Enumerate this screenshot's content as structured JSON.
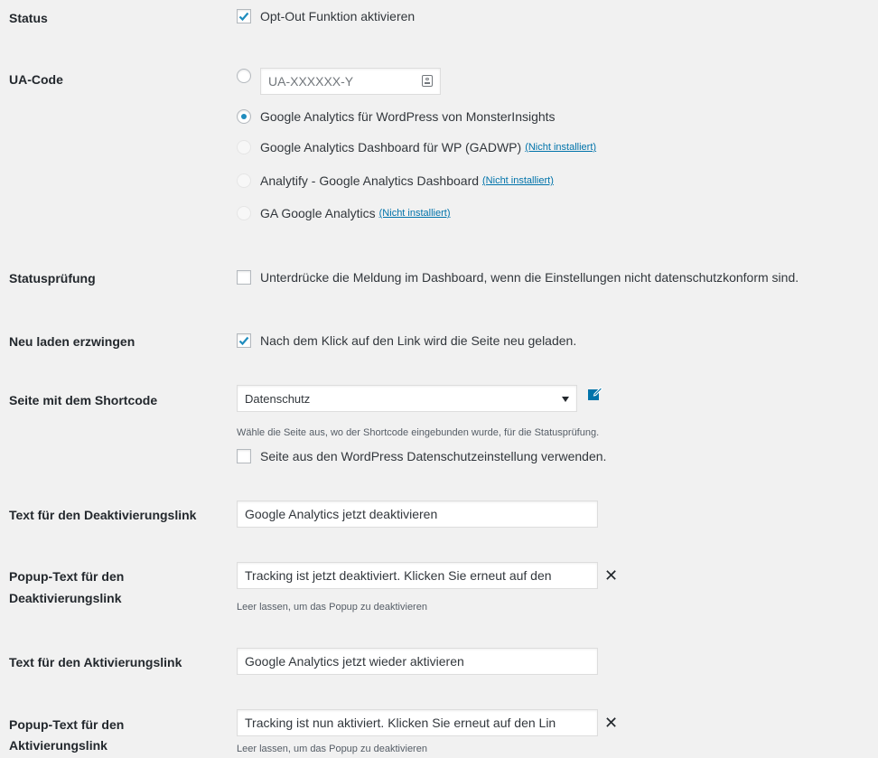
{
  "status": {
    "label": "Status",
    "checkbox_label": "Opt-Out Funktion aktivieren",
    "checked": true
  },
  "ua_code": {
    "label": "UA-Code",
    "input_placeholder": "UA-XXXXXX-Y",
    "options": [
      {
        "label": "Google Analytics für WordPress von MonsterInsights",
        "selected": true,
        "disabled": false,
        "note": ""
      },
      {
        "label": "Google Analytics Dashboard für WP (GADWP)",
        "selected": false,
        "disabled": true,
        "note": "(Nicht installiert)"
      },
      {
        "label": "Analytify - Google Analytics Dashboard",
        "selected": false,
        "disabled": true,
        "note": "(Nicht installiert)"
      },
      {
        "label": "GA Google Analytics",
        "selected": false,
        "disabled": true,
        "note": "(Nicht installiert)"
      }
    ]
  },
  "status_check": {
    "label": "Statusprüfung",
    "checkbox_label": "Unterdrücke die Meldung im Dashboard, wenn die Einstellungen nicht datenschutzkonform sind.",
    "checked": false
  },
  "force_reload": {
    "label": "Neu laden erzwingen",
    "checkbox_label": "Nach dem Klick auf den Link wird die Seite neu geladen.",
    "checked": true
  },
  "shortcode_page": {
    "label": "Seite mit dem Shortcode",
    "selected": "Datenschutz",
    "help": "Wähle die Seite aus, wo der Shortcode eingebunden wurde, für die Statusprüfung.",
    "checkbox_label": "Seite aus den WordPress Datenschutzeinstellung verwenden.",
    "checked": false
  },
  "deactivate_link_text": {
    "label": "Text für den Deaktivierungslink",
    "value": "Google Analytics jetzt deaktivieren"
  },
  "deactivate_popup": {
    "label_line1": "Popup-Text für den",
    "label_line2": "Deaktivierungslink",
    "value": "Tracking ist jetzt deaktiviert. Klicken Sie erneut auf den",
    "help": "Leer lassen, um das Popup zu deaktivieren"
  },
  "activate_link_text": {
    "label": "Text für den Aktivierungslink",
    "value": "Google Analytics jetzt wieder aktivieren"
  },
  "activate_popup": {
    "label_line1": "Popup-Text für den",
    "label_line2": "Aktivierungslink",
    "value": "Tracking ist nun aktiviert. Klicken Sie erneut auf den Lin",
    "help": "Leer lassen, um das Popup zu deaktivieren"
  },
  "colors": {
    "accent": "#1e8cbe",
    "link": "#0073aa",
    "background": "#f1f1f1"
  }
}
